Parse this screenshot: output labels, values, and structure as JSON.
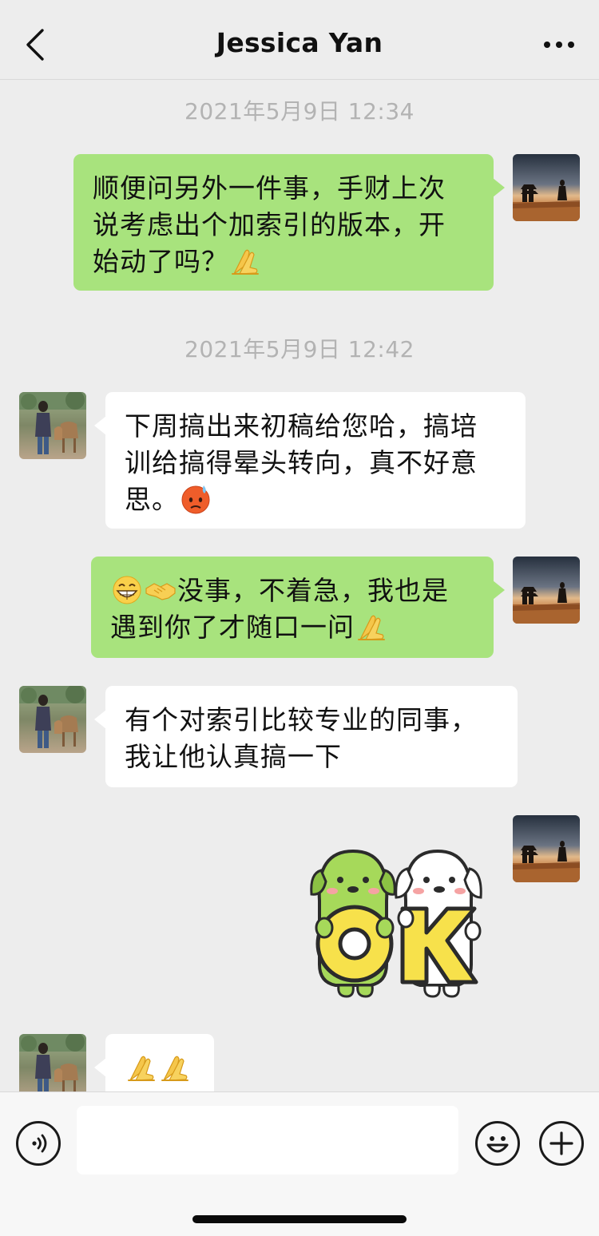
{
  "header": {
    "title": "Jessica Yan",
    "back_icon": "chevron-left-icon",
    "more_icon": "more-horizontal-icon"
  },
  "messages": [
    {
      "type": "time",
      "text": "2021年5月9日 12:34"
    },
    {
      "type": "text",
      "from": "me",
      "text_lines": [
        "顺便问另外一件事，手财上次",
        "说考虑出个加索引的版本，开",
        "始动了吗？"
      ],
      "emoji": [
        "folded-hands-emoji"
      ]
    },
    {
      "type": "time",
      "text": "2021年5月9日 12:42"
    },
    {
      "type": "text",
      "from": "other",
      "text_lines": [
        "下周搞出来初稿给您哈，搞培",
        "训给搞得晕头转向，真不好意",
        "思。"
      ],
      "emoji": [
        "hot-face-emoji"
      ]
    },
    {
      "type": "text",
      "from": "me",
      "text_lines": [
        "没事，不着急，我也是",
        "遇到你了才随口一问"
      ],
      "emoji": [
        "grinning-face-emoji",
        "handshake-emoji",
        "folded-hands-emoji"
      ]
    },
    {
      "type": "text",
      "from": "other",
      "text_lines": [
        "有个对索引比较专业的同事，",
        "我让他认真搞一下"
      ]
    },
    {
      "type": "sticker",
      "from": "me",
      "text": "OK"
    },
    {
      "type": "text",
      "from": "other",
      "emoji": [
        "folded-hands-emoji",
        "folded-hands-emoji"
      ]
    }
  ],
  "input_bar": {
    "voice_icon": "voice-icon",
    "input_value": "",
    "emoji_icon": "emoji-icon",
    "plus_icon": "plus-icon"
  },
  "colors": {
    "background": "#ededed",
    "my_bubble": "#a8e37d",
    "their_bubble": "#ffffff",
    "timestamp": "#b3b3b3",
    "sticker_yellow": "#f7e14b",
    "sticker_green": "#a6d95a"
  }
}
